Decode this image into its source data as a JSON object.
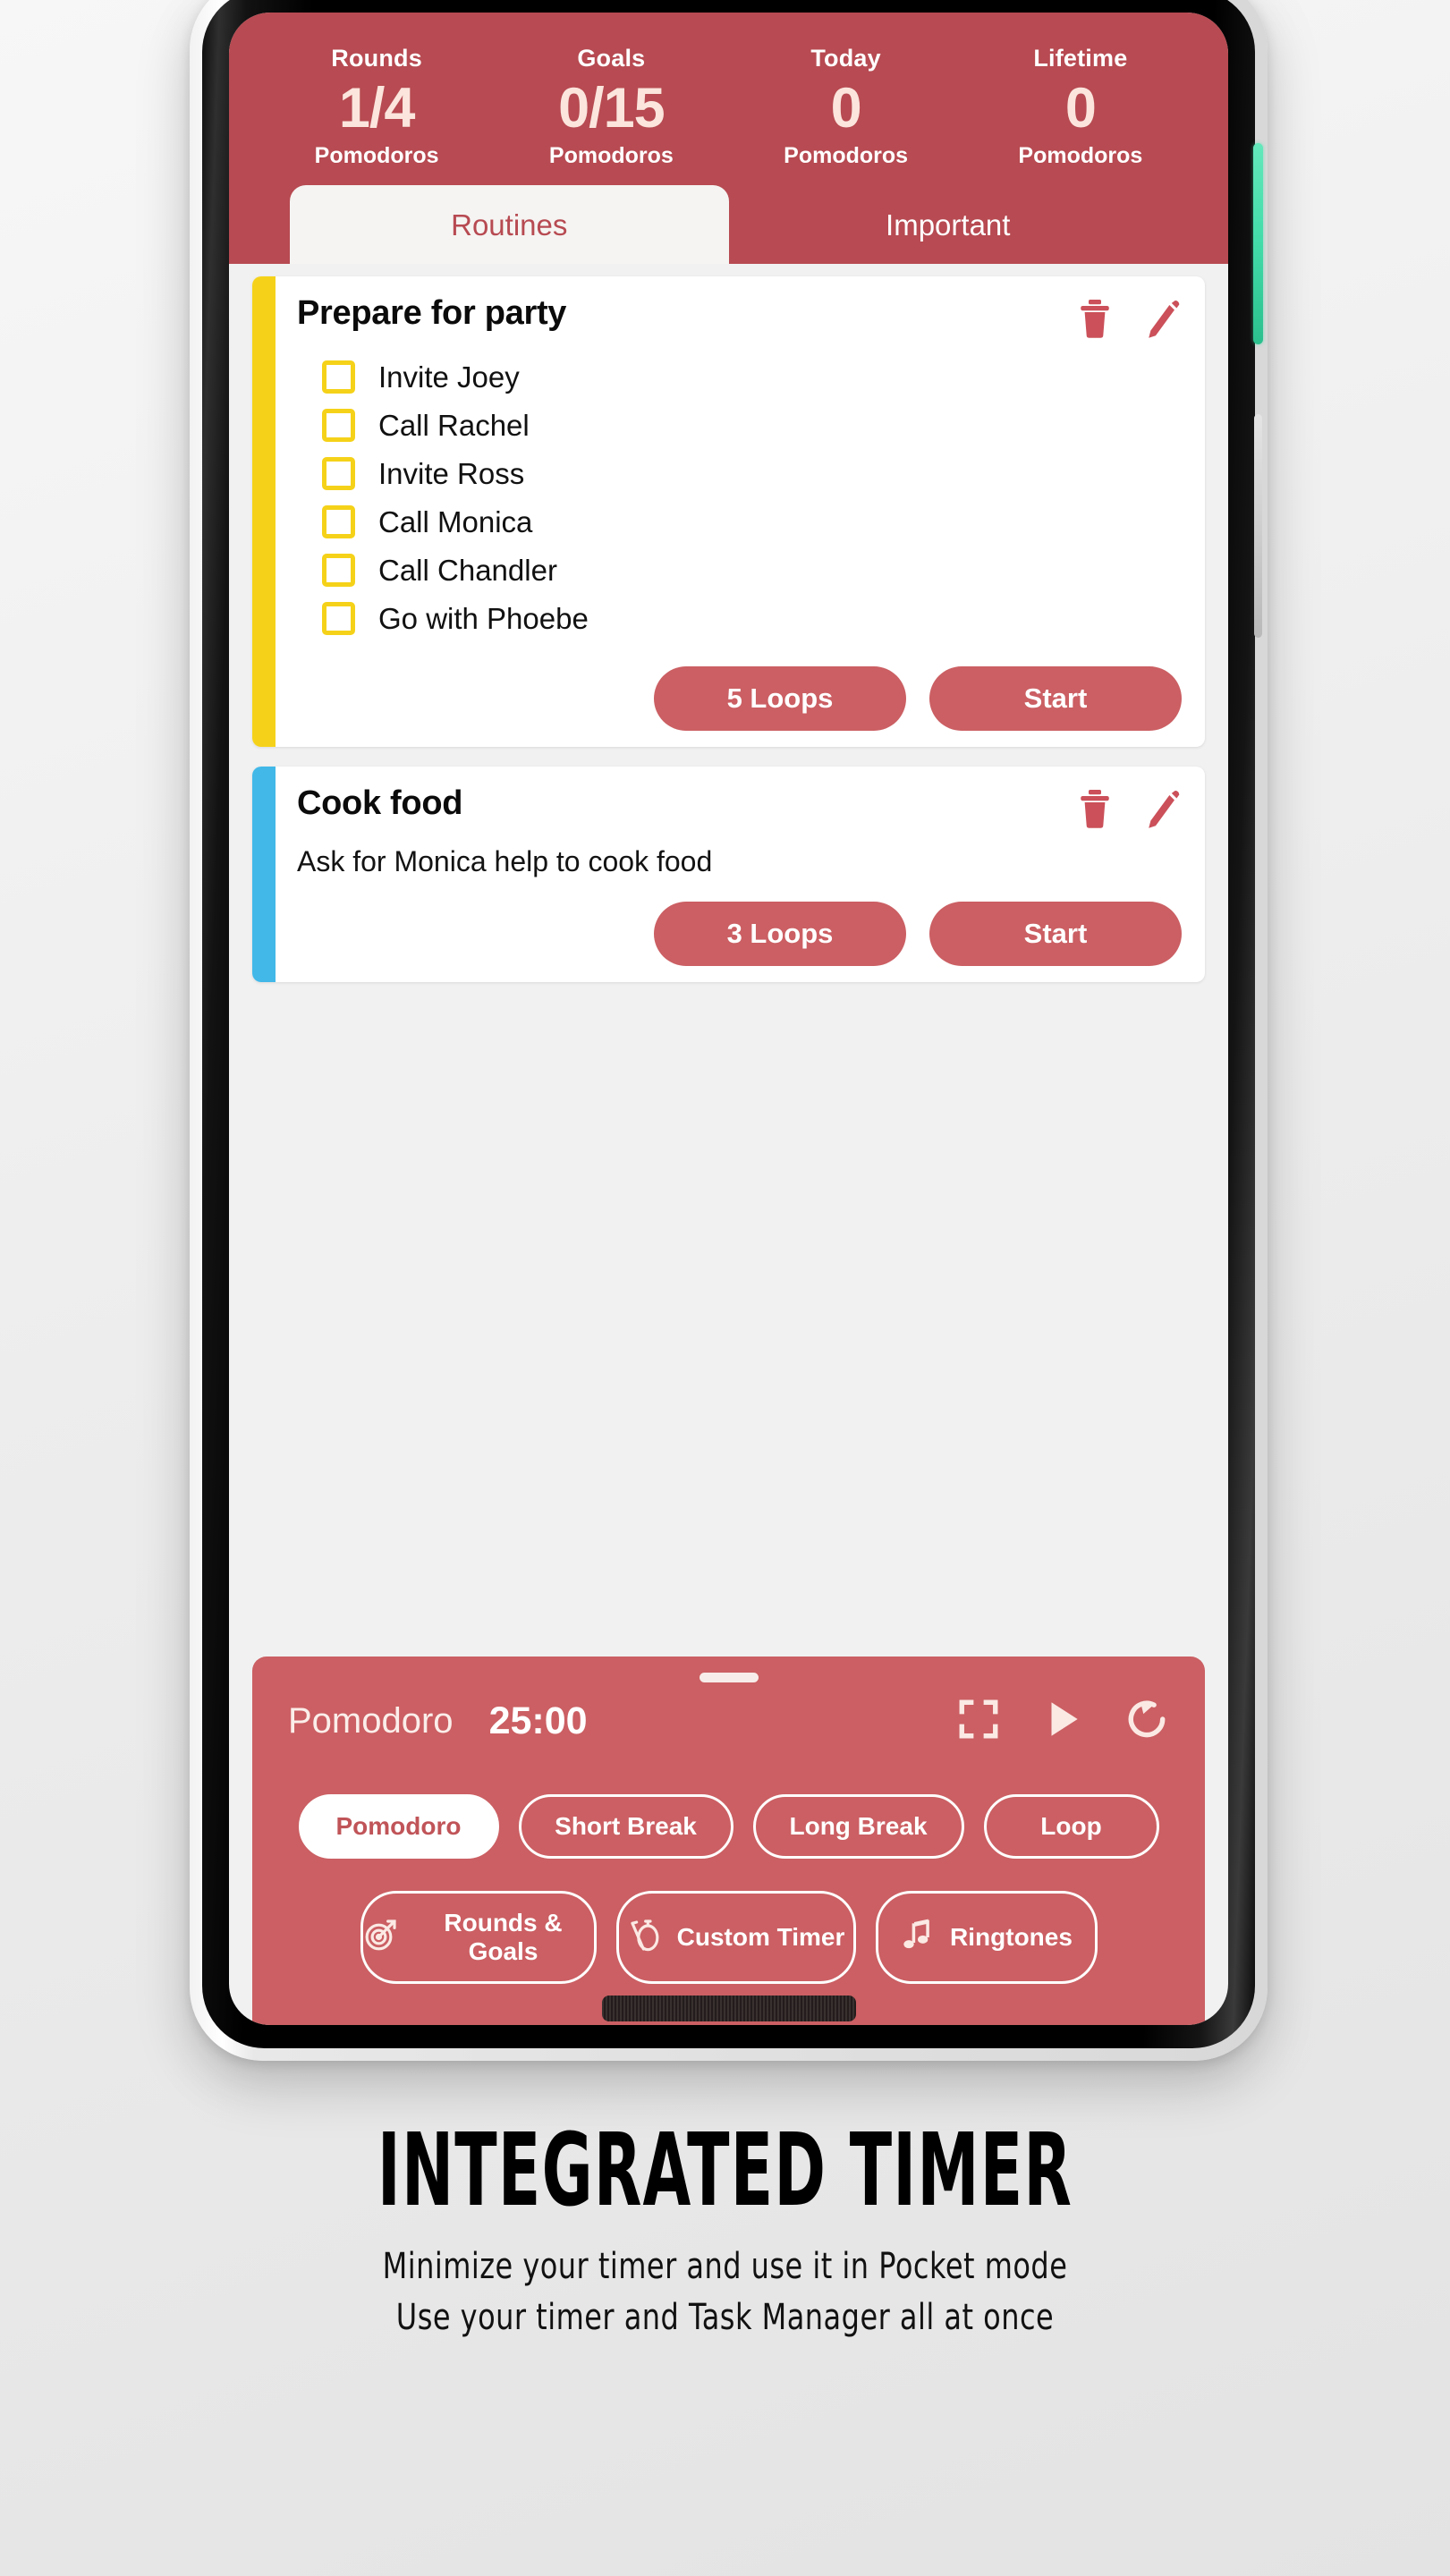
{
  "stats": {
    "columns": [
      {
        "label": "Rounds",
        "value": "1/4",
        "unit": "Pomodoros"
      },
      {
        "label": "Goals",
        "value": "0/15",
        "unit": "Pomodoros"
      },
      {
        "label": "Today",
        "value": "0",
        "unit": "Pomodoros"
      },
      {
        "label": "Lifetime",
        "value": "0",
        "unit": "Pomodoros"
      }
    ]
  },
  "tabs": [
    {
      "label": "Routines",
      "active": true
    },
    {
      "label": "Important",
      "active": false
    }
  ],
  "tasks": [
    {
      "title": "Prepare for party",
      "accent": "#f5d219",
      "description": "",
      "checklist": [
        "Invite Joey",
        "Call Rachel",
        "Invite Ross",
        "Call Monica",
        "Call Chandler",
        "Go with Phoebe"
      ],
      "loops_label": "5 Loops",
      "start_label": "Start",
      "delete_icon": "trash-icon",
      "edit_icon": "pencil-icon"
    },
    {
      "title": "Cook food",
      "accent": "#41b8e8",
      "description": "Ask for Monica help to cook food",
      "checklist": [],
      "loops_label": "3 Loops",
      "start_label": "Start",
      "delete_icon": "trash-icon",
      "edit_icon": "pencil-icon"
    }
  ],
  "timer": {
    "mode_label": "Pomodoro",
    "time": "25:00",
    "controls": [
      {
        "name": "fullscreen-icon"
      },
      {
        "name": "play-icon"
      },
      {
        "name": "reset-icon"
      }
    ],
    "modes": [
      {
        "label": "Pomodoro",
        "active": true
      },
      {
        "label": "Short Break",
        "active": false
      },
      {
        "label": "Long Break",
        "active": false
      },
      {
        "label": "Loop",
        "active": false
      }
    ],
    "settings": [
      {
        "label": "Rounds & Goals",
        "icon": "target-icon"
      },
      {
        "label": "Custom Timer",
        "icon": "stopwatch-icon"
      },
      {
        "label": "Ringtones",
        "icon": "music-note-icon"
      }
    ]
  },
  "caption": {
    "headline": "INTEGRATED TIMER",
    "lines": [
      "Minimize your timer and use it in Pocket mode",
      "Use your timer and Task Manager all at once"
    ]
  },
  "colors": {
    "header_red": "#b74a52",
    "panel_red": "#cb5f63",
    "accent_yellow": "#f5d219",
    "accent_blue": "#41b8e8",
    "power_button_green": "#42dca9"
  }
}
